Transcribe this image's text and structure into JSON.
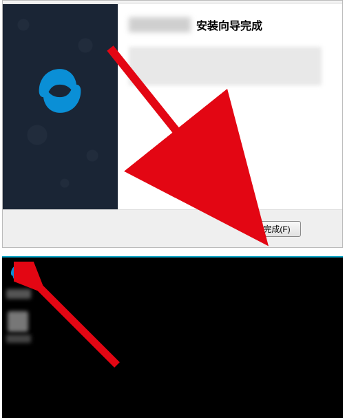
{
  "installer": {
    "title": "安装向导完成",
    "sidebar": {
      "logo_name": "swirl-logo"
    },
    "finish_button_label": "完成(F)"
  },
  "desktop": {
    "app_icon_name": "swirl-logo"
  },
  "annotation": {
    "arrow_color": "#e30613"
  }
}
